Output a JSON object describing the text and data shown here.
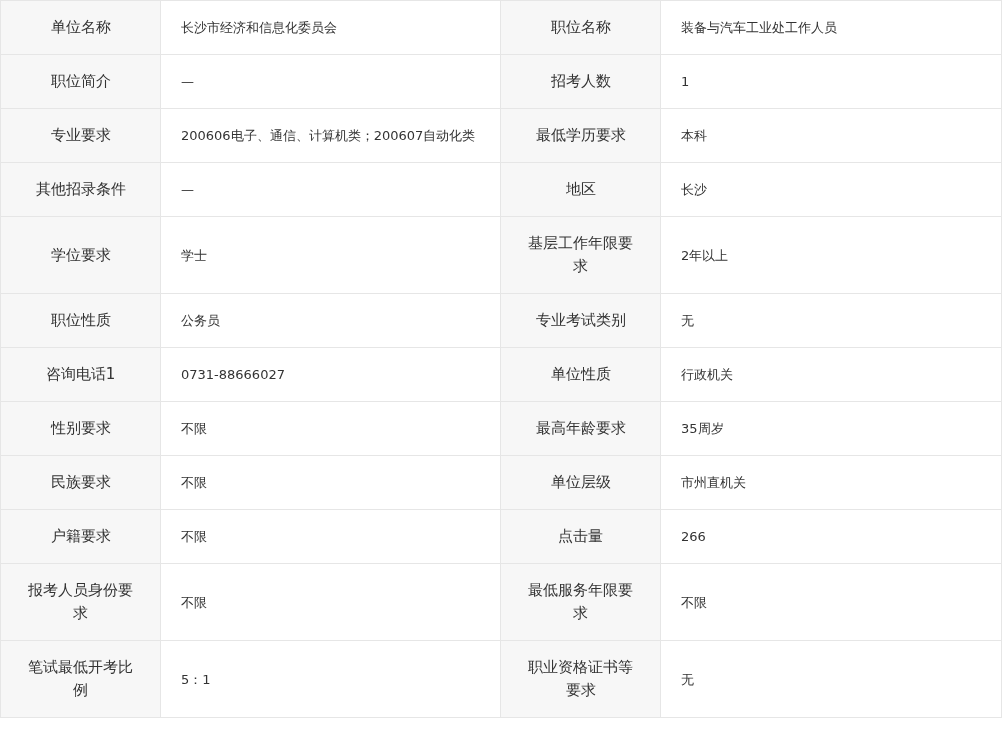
{
  "rows": [
    [
      {
        "label": "单位名称",
        "value": "长沙市经济和信息化委员会"
      },
      {
        "label": "职位名称",
        "value": "装备与汽车工业处工作人员"
      }
    ],
    [
      {
        "label": "职位简介",
        "value": "—"
      },
      {
        "label": "招考人数",
        "value": "1"
      }
    ],
    [
      {
        "label": "专业要求",
        "value": "200606电子、通信、计算机类；200607自动化类"
      },
      {
        "label": "最低学历要求",
        "value": "本科"
      }
    ],
    [
      {
        "label": "其他招录条件",
        "value": "—"
      },
      {
        "label": "地区",
        "value": "长沙"
      }
    ],
    [
      {
        "label": "学位要求",
        "value": "学士"
      },
      {
        "label": "基层工作年限要求",
        "value": "2年以上"
      }
    ],
    [
      {
        "label": "职位性质",
        "value": "公务员"
      },
      {
        "label": "专业考试类别",
        "value": "无"
      }
    ],
    [
      {
        "label": "咨询电话1",
        "value": "0731-88666027"
      },
      {
        "label": "单位性质",
        "value": "行政机关"
      }
    ],
    [
      {
        "label": "性别要求",
        "value": "不限"
      },
      {
        "label": "最高年龄要求",
        "value": "35周岁"
      }
    ],
    [
      {
        "label": "民族要求",
        "value": "不限"
      },
      {
        "label": "单位层级",
        "value": "市州直机关"
      }
    ],
    [
      {
        "label": "户籍要求",
        "value": "不限"
      },
      {
        "label": "点击量",
        "value": "266"
      }
    ],
    [
      {
        "label": "报考人员身份要求",
        "value": "不限"
      },
      {
        "label": "最低服务年限要求",
        "value": "不限"
      }
    ],
    [
      {
        "label": "笔试最低开考比例",
        "value": "5：1"
      },
      {
        "label": "职业资格证书等要求",
        "value": "无"
      }
    ]
  ]
}
